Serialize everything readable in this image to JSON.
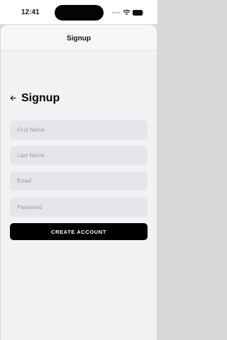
{
  "status_bar": {
    "time": "12:41",
    "icons": [
      "signal-dots-icon",
      "wifi-icon",
      "battery-icon"
    ]
  },
  "nav": {
    "title": "Signup"
  },
  "header": {
    "back_icon": "back-arrow-icon",
    "title": "Signup"
  },
  "form": {
    "first_name": {
      "value": "",
      "placeholder": "First Name"
    },
    "last_name": {
      "value": "",
      "placeholder": "Last Name"
    },
    "email": {
      "value": "",
      "placeholder": "Email"
    },
    "password": {
      "value": "",
      "placeholder": "Password"
    },
    "submit_label": "CREATE ACCOUNT"
  },
  "colors": {
    "background": "#f2f2f4",
    "field_background": "#e6e6ea",
    "button_background": "#000000",
    "button_text": "#ffffff"
  }
}
